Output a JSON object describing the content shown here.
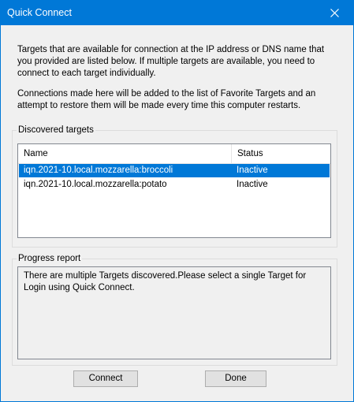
{
  "window": {
    "title": "Quick Connect",
    "accent_color": "#0078d7",
    "close_icon": "close-icon"
  },
  "intro": {
    "paragraph1": "Targets that are available for connection at the IP address or DNS name that you provided are listed below.  If multiple targets are available, you need to connect to each target individually.",
    "paragraph2": "Connections made here will be added to the list of Favorite Targets and an attempt to restore them will be made every time this computer restarts."
  },
  "discovered": {
    "group_label": "Discovered targets",
    "columns": [
      "Name",
      "Status"
    ],
    "rows": [
      {
        "name": "iqn.2021-10.local.mozzarella:broccoli",
        "status": "Inactive",
        "selected": true
      },
      {
        "name": "iqn.2021-10.local.mozzarella:potato",
        "status": "Inactive",
        "selected": false
      }
    ]
  },
  "progress": {
    "group_label": "Progress report",
    "message": "There are multiple Targets discovered.Please select a single Target for Login using Quick Connect."
  },
  "buttons": {
    "connect": "Connect",
    "done": "Done"
  }
}
